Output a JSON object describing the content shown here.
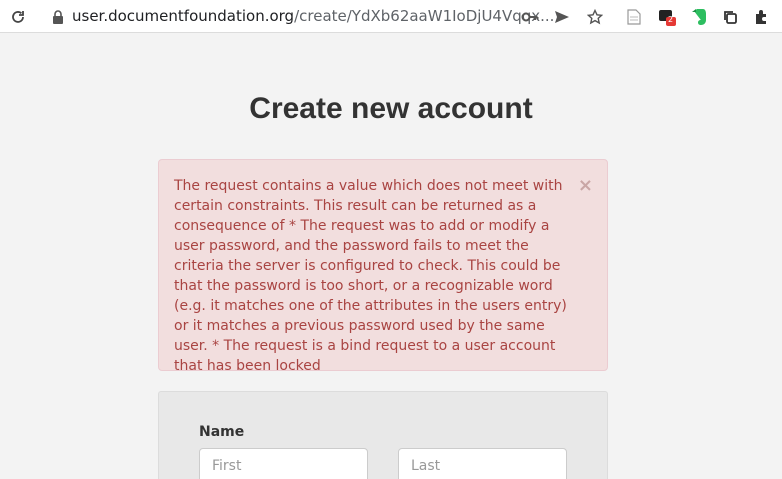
{
  "browser": {
    "url_domain": "user.documentfoundation.org",
    "url_path": "/create/YdXb62aaW1IoDjU4Vqqx...",
    "extension_badge": "2"
  },
  "page": {
    "title": "Create new account"
  },
  "alert": {
    "message": "The request contains a value which does not meet with certain constraints. This result can be returned as a consequence of * The request was to add or modify a user password, and the password fails to meet the criteria the server is configured to check. This could be that the password is too short, or a recognizable word (e.g. it matches one of the attributes in the users entry) or it matches a previous password used by the same user. * The request is a bind request to a user account that has been locked",
    "close_symbol": "×"
  },
  "form": {
    "name_label": "Name",
    "first_placeholder": "First",
    "last_placeholder": "Last"
  }
}
